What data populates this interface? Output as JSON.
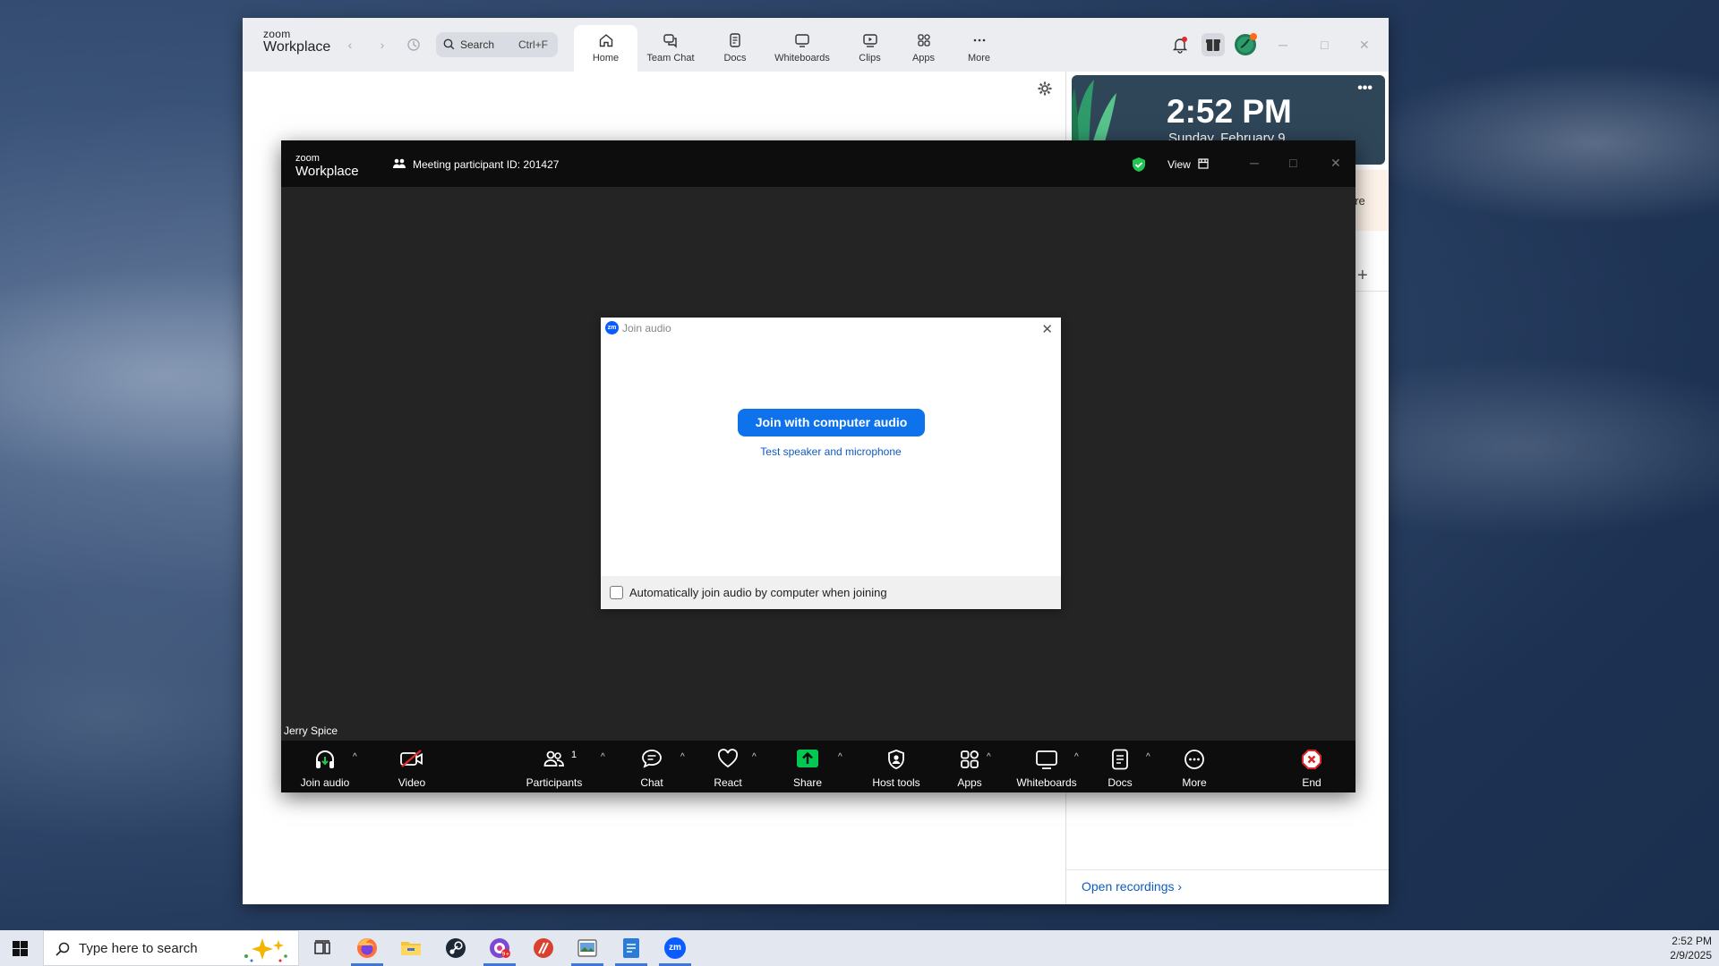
{
  "workplace": {
    "brand_top": "zoom",
    "brand_bottom": "Workplace",
    "search_placeholder": "Search",
    "search_shortcut": "Ctrl+F",
    "tabs": [
      {
        "label": "Home"
      },
      {
        "label": "Team Chat"
      },
      {
        "label": "Docs"
      },
      {
        "label": "Whiteboards"
      },
      {
        "label": "Clips"
      },
      {
        "label": "Apps"
      },
      {
        "label": "More"
      }
    ],
    "side_card": {
      "time": "2:52 PM",
      "date": "Sunday, February 9"
    },
    "side_partial_text": "ore",
    "open_recordings": "Open recordings"
  },
  "meeting": {
    "brand_top": "zoom",
    "brand_bottom": "Workplace",
    "participant_id": "Meeting participant ID: 201427",
    "view_label": "View",
    "participant_name": "Jerry Spice",
    "participants_count": "1",
    "toolbar": [
      {
        "label": "Join audio"
      },
      {
        "label": "Video"
      },
      {
        "label": "Participants"
      },
      {
        "label": "Chat"
      },
      {
        "label": "React"
      },
      {
        "label": "Share"
      },
      {
        "label": "Host tools"
      },
      {
        "label": "Apps"
      },
      {
        "label": "Whiteboards"
      },
      {
        "label": "Docs"
      },
      {
        "label": "More"
      },
      {
        "label": "End"
      }
    ],
    "colors": {
      "share_green": "#00c853",
      "end_red": "#e02828",
      "video_off_red": "#e02828"
    }
  },
  "dialog": {
    "logo": "zm",
    "title": "Join audio",
    "join_button": "Join with computer audio",
    "test_link": "Test speaker and microphone",
    "auto_join_label": "Automatically join audio by computer when joining",
    "auto_join_checked": false,
    "accent": "#0e72ed"
  },
  "taskbar": {
    "search_placeholder": "Type here to search",
    "zoom_icon_label": "zm",
    "clock_time": "2:52 PM",
    "clock_date": "2/9/2025"
  }
}
